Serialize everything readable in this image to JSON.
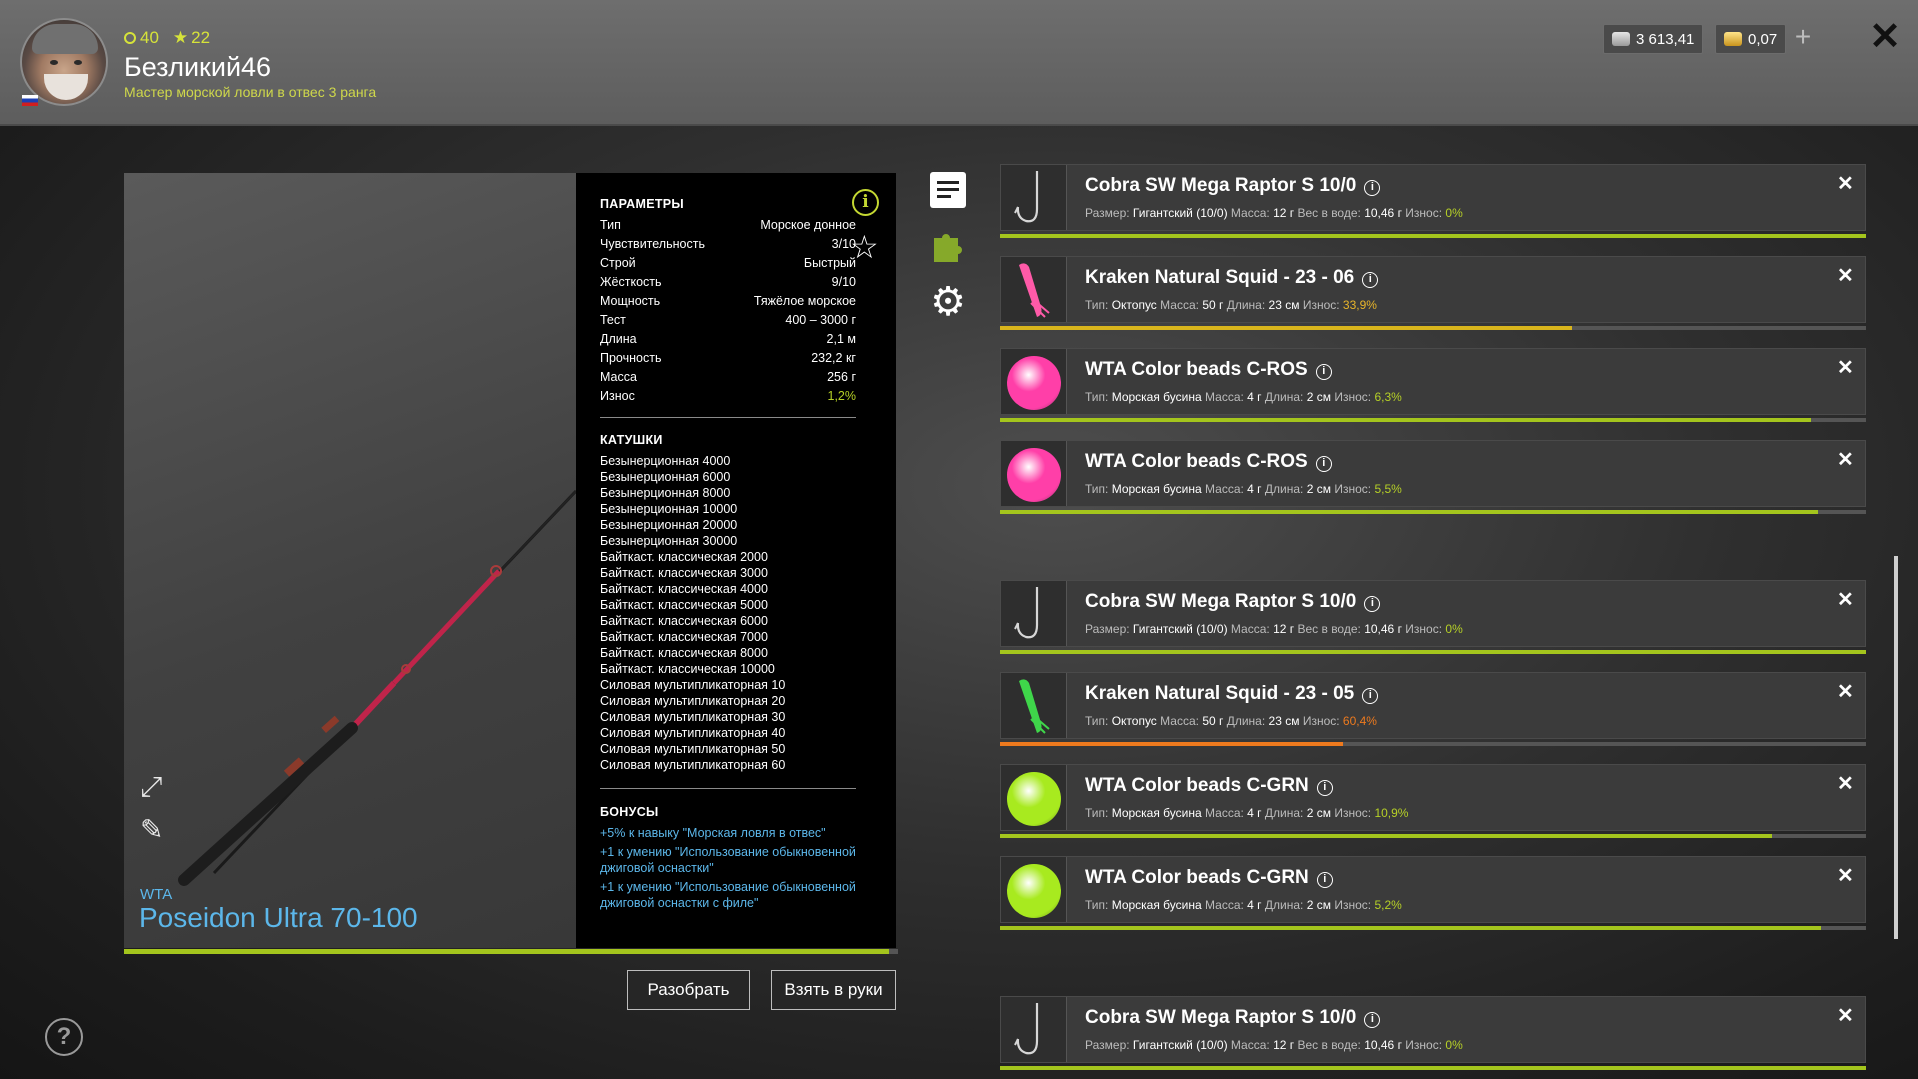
{
  "header": {
    "level_currency": "40",
    "stars": "22",
    "username": "Безликий46",
    "rank": "Мастер морской ловли в отвес 3 ранга",
    "silver": "3 613,41",
    "gold": "0,07"
  },
  "rod": {
    "brand": "WTA",
    "name": "Poseidon Ultra 70-100",
    "wear_fraction": 0.988
  },
  "params": {
    "title": "ПАРАМЕТРЫ",
    "rows": [
      {
        "k": "Тип",
        "v": "Морское донное"
      },
      {
        "k": "Чувствительность",
        "v": "3/10"
      },
      {
        "k": "Строй",
        "v": "Быстрый"
      },
      {
        "k": "Жёсткость",
        "v": "9/10"
      },
      {
        "k": "Мощность",
        "v": "Тяжёлое морское"
      },
      {
        "k": "Тест",
        "v": "400 – 3000 г"
      },
      {
        "k": "Длина",
        "v": "2,1 м"
      },
      {
        "k": "Прочность",
        "v": "232,2 кг"
      },
      {
        "k": "Масса",
        "v": "256 г"
      },
      {
        "k": "Износ",
        "v": "1,2%"
      }
    ]
  },
  "reels": {
    "title": "КАТУШКИ",
    "items": [
      "Безынерционная 4000",
      "Безынерционная 6000",
      "Безынерционная 8000",
      "Безынерционная 10000",
      "Безынерционная 20000",
      "Безынерционная 30000",
      "Байткаст. классическая 2000",
      "Байткаст. классическая 3000",
      "Байткаст. классическая 4000",
      "Байткаст. классическая 5000",
      "Байткаст. классическая 6000",
      "Байткаст. классическая 7000",
      "Байткаст. классическая 8000",
      "Байткаст. классическая 10000",
      "Силовая мультипликаторная 10",
      "Силовая мультипликаторная 20",
      "Силовая мультипликаторная 30",
      "Силовая мультипликаторная 40",
      "Силовая мультипликаторная 50",
      "Силовая мультипликаторная 60"
    ]
  },
  "bonuses": {
    "title": "БОНУСЫ",
    "items": [
      "+5% к навыку \"Морская ловля в отвес\"",
      "+1 к умению \"Использование обыкновенной джиговой оснастки\"",
      "+1 к умению \"Использование обыкновенной джиговой оснастки с филе\""
    ]
  },
  "buttons": {
    "disassemble": "Разобрать",
    "take": "Взять в руки"
  },
  "tackle": [
    {
      "name": "Cobra SW Mega Raptor S 10/0",
      "kind": "hook",
      "color": "#d7d7d7",
      "desc": [
        [
          "Размер:",
          "Гигантский (10/0)"
        ],
        [
          "Масса:",
          "12 г"
        ],
        [
          "Вес в воде:",
          "10,46 г"
        ]
      ],
      "wear": "0%",
      "wear_class": "g",
      "condition": 1.0,
      "bar_color": "#a4c51d"
    },
    {
      "name": "Kraken Natural Squid - 23 - 06",
      "kind": "squid",
      "color": "#ff5aa8",
      "desc": [
        [
          "Тип:",
          "Октопус"
        ],
        [
          "Масса:",
          "50 г"
        ],
        [
          "Длина:",
          "23 см"
        ]
      ],
      "wear": "33,9%",
      "wear_class": "y",
      "condition": 0.661,
      "bar_color": "#d9b51c"
    },
    {
      "name": "WTA Color beads C-ROS",
      "kind": "bead",
      "color": "#ff3fa8",
      "desc": [
        [
          "Тип:",
          "Морская бусина"
        ],
        [
          "Масса:",
          "4 г"
        ],
        [
          "Длина:",
          "2 см"
        ]
      ],
      "wear": "6,3%",
      "wear_class": "g",
      "condition": 0.937,
      "bar_color": "#a4c51d"
    },
    {
      "name": "WTA Color beads C-ROS",
      "kind": "bead",
      "color": "#ff3fa8",
      "desc": [
        [
          "Тип:",
          "Морская бусина"
        ],
        [
          "Масса:",
          "4 г"
        ],
        [
          "Длина:",
          "2 см"
        ]
      ],
      "wear": "5,5%",
      "wear_class": "g",
      "condition": 0.945,
      "bar_color": "#a4c51d"
    },
    {
      "name": "Cobra SW Mega Raptor S 10/0",
      "kind": "hook",
      "color": "#d7d7d7",
      "desc": [
        [
          "Размер:",
          "Гигантский (10/0)"
        ],
        [
          "Масса:",
          "12 г"
        ],
        [
          "Вес в воде:",
          "10,46 г"
        ]
      ],
      "wear": "0%",
      "wear_class": "g",
      "condition": 1.0,
      "bar_color": "#a4c51d"
    },
    {
      "name": "Kraken Natural Squid - 23 - 05",
      "kind": "squid",
      "color": "#3fd64a",
      "desc": [
        [
          "Тип:",
          "Октопус"
        ],
        [
          "Масса:",
          "50 г"
        ],
        [
          "Длина:",
          "23 см"
        ]
      ],
      "wear": "60,4%",
      "wear_class": "o",
      "condition": 0.396,
      "bar_color": "#ee7a1e"
    },
    {
      "name": "WTA Color beads C-GRN",
      "kind": "bead",
      "color": "#a8ea1f",
      "desc": [
        [
          "Тип:",
          "Морская бусина"
        ],
        [
          "Масса:",
          "4 г"
        ],
        [
          "Длина:",
          "2 см"
        ]
      ],
      "wear": "10,9%",
      "wear_class": "g",
      "condition": 0.891,
      "bar_color": "#a4c51d"
    },
    {
      "name": "WTA Color beads C-GRN",
      "kind": "bead",
      "color": "#a8ea1f",
      "desc": [
        [
          "Тип:",
          "Морская бусина"
        ],
        [
          "Масса:",
          "4 г"
        ],
        [
          "Длина:",
          "2 см"
        ]
      ],
      "wear": "5,2%",
      "wear_class": "g",
      "condition": 0.948,
      "bar_color": "#a4c51d"
    },
    {
      "name": "Cobra SW Mega Raptor S 10/0",
      "kind": "hook",
      "color": "#d7d7d7",
      "desc": [
        [
          "Размер:",
          "Гигантский (10/0)"
        ],
        [
          "Масса:",
          "12 г"
        ],
        [
          "Вес в воде:",
          "10,46 г"
        ]
      ],
      "wear": "0%",
      "wear_class": "g",
      "condition": 1.0,
      "bar_color": "#a4c51d"
    }
  ],
  "wear_label": "Износ:"
}
